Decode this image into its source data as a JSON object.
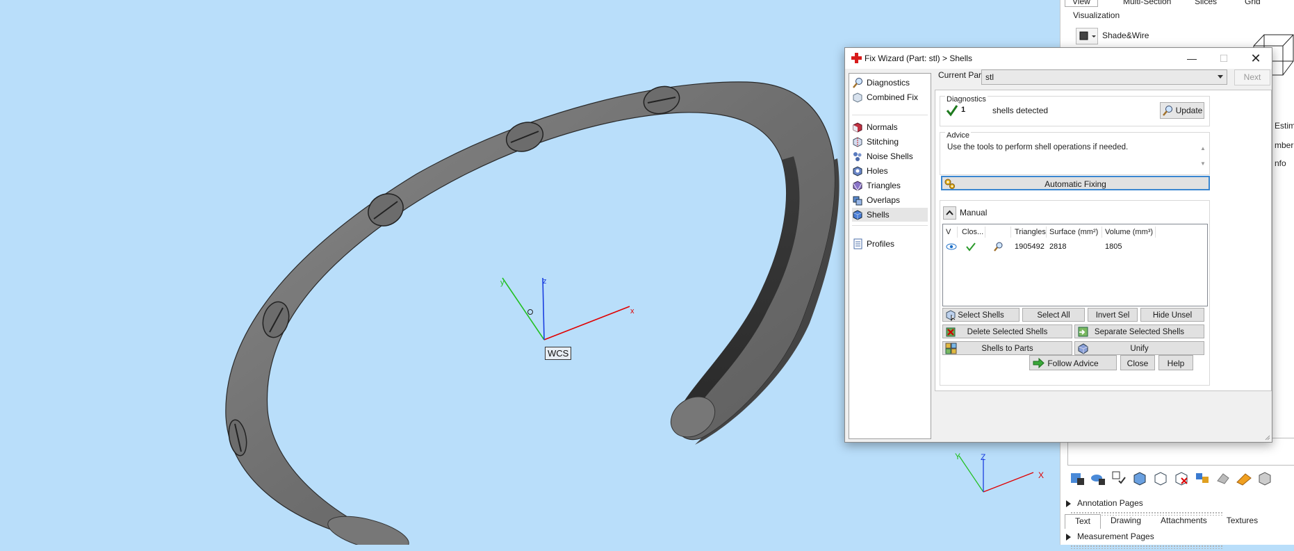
{
  "viewport": {
    "wcs_label": "WCS",
    "axis_x": "x",
    "axis_y": "y",
    "axis_z": "z",
    "mini_axis_x": "X",
    "mini_axis_y": "Y",
    "mini_axis_z": "Z",
    "background": "#b9defa"
  },
  "right_panel": {
    "tabs": [
      "View",
      "Multi-Section",
      "Slices",
      "Grid"
    ],
    "visualization_label": "Visualization",
    "shade_mode": "Shade&Wire",
    "side_texts": [
      "Estima",
      "mber o",
      "nfo"
    ],
    "annotation_pages": "Annotation Pages",
    "subtabs": [
      "Text",
      "Drawing",
      "Attachments",
      "Textures"
    ],
    "measurement_pages": "Measurement Pages"
  },
  "dialog": {
    "title": "Fix Wizard (Part: stl) > Shells",
    "nav_items": [
      "Diagnostics",
      "Combined Fix",
      "Normals",
      "Stitching",
      "Noise Shells",
      "Holes",
      "Triangles",
      "Overlaps",
      "Shells",
      "Profiles"
    ],
    "selected_nav": "Shells",
    "current_part_label": "Current Part:",
    "current_part_value": "stl",
    "next_label": "Next",
    "diagnostics_title": "Diagnostics",
    "diagnostics_count": "1",
    "diagnostics_text": "shells detected",
    "update_label": "Update",
    "advice_title": "Advice",
    "advice_text": "Use the tools to perform shell operations if needed.",
    "automatic_fixing_label": "Automatic Fixing",
    "manual_title": "Manual",
    "table": {
      "headers": [
        "V",
        "Clos...",
        "",
        "Triangles",
        "Surface (mm²)",
        "Volume (mm³)"
      ],
      "row": {
        "triangles": "1905492",
        "surface": "2818",
        "volume": "1805"
      }
    },
    "buttons": {
      "select_shells": "Select Shells",
      "select_all": "Select All",
      "invert_sel": "Invert Sel",
      "hide_unsel": "Hide Unsel",
      "delete_selected": "Delete Selected Shells",
      "separate_selected": "Separate Selected Shells",
      "shells_to_parts": "Shells to Parts",
      "unify": "Unify",
      "follow_advice": "Follow Advice",
      "close": "Close",
      "help": "Help"
    }
  },
  "colors": {
    "accent_blue": "#3a86d0",
    "check_green": "#2a9a2a",
    "axis_red": "#e00000",
    "axis_green": "#22c022",
    "axis_blue": "#1a3fe0"
  }
}
